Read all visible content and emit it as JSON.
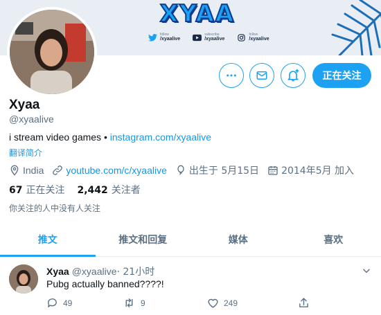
{
  "banner": {
    "logo_text": "XYAA",
    "socials": [
      {
        "icon": "twitter-icon",
        "caption": "follow",
        "handle": "/xyaalive"
      },
      {
        "icon": "youtube-icon",
        "caption": "subscribe",
        "handle": "/xyaalive"
      },
      {
        "icon": "instagram-icon",
        "caption": "follow",
        "handle": "/xyaalive"
      }
    ]
  },
  "actions": {
    "more_icon": "more-dots-icon",
    "message_icon": "mail-icon",
    "notify_icon": "notification-bell-icon",
    "follow_label": "正在关注"
  },
  "profile": {
    "name": "Xyaa",
    "handle": "@xyaalive",
    "bio_text": "i stream video games • ",
    "bio_link": "instagram.com/xyaalive",
    "translate": "翻译简介",
    "location": "India",
    "website": "youtube.com/c/xyaalive",
    "birthday": "出生于 5月15日",
    "joined": "2014年5月 加入",
    "following_count": "67",
    "following_label": "正在关注",
    "followers_count": "2,442",
    "followers_label": "关注者",
    "mutuals_note": "你关注的人中没有人关注"
  },
  "tabs": [
    {
      "label": "推文",
      "active": true
    },
    {
      "label": "推文和回复",
      "active": false
    },
    {
      "label": "媒体",
      "active": false
    },
    {
      "label": "喜欢",
      "active": false
    }
  ],
  "tweet": {
    "name": "Xyaa",
    "handle": "@xyaalive",
    "time": " · 21小时",
    "text": "Pubg actually banned????!",
    "replies": "49",
    "retweets": "9",
    "likes": "249"
  },
  "colors": {
    "accent": "#1da1f2",
    "link": "#1b95e0",
    "secondary_text": "#5b7083",
    "banner_bg": "#e9eef5"
  }
}
